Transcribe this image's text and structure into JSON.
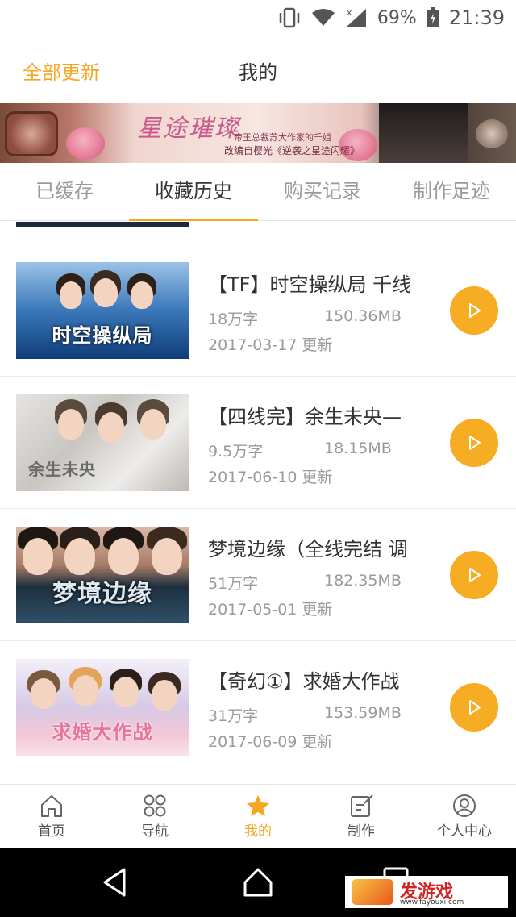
{
  "status_bar": {
    "battery": "69%",
    "time": "21:39"
  },
  "header": {
    "update_all": "全部更新",
    "title": "我的"
  },
  "banner": {
    "title": "星途璀璨",
    "subtitle": "帝王总裁苏大作家的千姐",
    "caption": "改编自樱光《逆袭之星途闪耀》"
  },
  "tabs": [
    {
      "label": "已缓存",
      "active": false
    },
    {
      "label": "收藏历史",
      "active": true
    },
    {
      "label": "购买记录",
      "active": false
    },
    {
      "label": "制作足迹",
      "active": false
    }
  ],
  "items": [
    {
      "name": "【TF】时空操纵局 千线",
      "words": "18万字",
      "size": "150.36MB",
      "date": "2017-03-17",
      "update": "更新",
      "thumb_text": "时空操纵局"
    },
    {
      "name": "【四线完】余生未央—",
      "words": "9.5万字",
      "size": "18.15MB",
      "date": "2017-06-10",
      "update": "更新",
      "thumb_text": "余生未央"
    },
    {
      "name": "梦境边缘（全线完结 调",
      "words": "51万字",
      "size": "182.35MB",
      "date": "2017-05-01",
      "update": "更新",
      "thumb_text": "梦境边缘"
    },
    {
      "name": "【奇幻①】求婚大作战",
      "words": "31万字",
      "size": "153.59MB",
      "date": "2017-06-09",
      "update": "更新",
      "thumb_text": "求婚大作战"
    }
  ],
  "bottom_nav": [
    {
      "label": "首页",
      "icon": "home-icon",
      "active": false
    },
    {
      "label": "导航",
      "icon": "grid-icon",
      "active": false
    },
    {
      "label": "我的",
      "icon": "star-icon",
      "active": true
    },
    {
      "label": "制作",
      "icon": "edit-icon",
      "active": false
    },
    {
      "label": "个人中心",
      "icon": "user-icon",
      "active": false
    }
  ],
  "watermark": {
    "text": "发游戏",
    "url": "www.fayouxi.com"
  },
  "colors": {
    "accent": "#f5a623",
    "text": "#333333",
    "muted": "#9a9a9a"
  }
}
